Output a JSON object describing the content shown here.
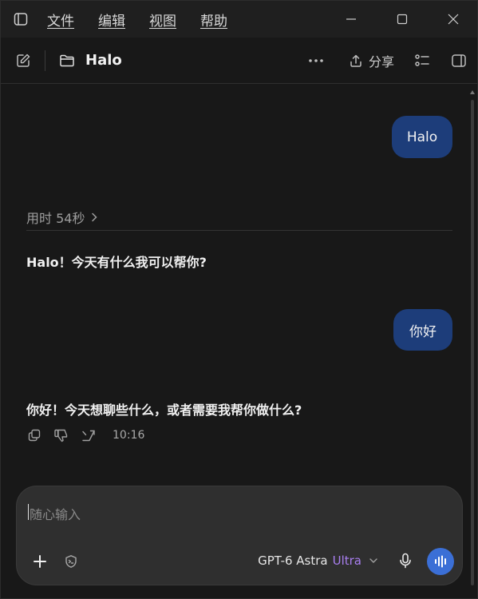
{
  "menu": {
    "items": [
      "文件",
      "编辑",
      "视图",
      "帮助"
    ]
  },
  "toolbar": {
    "title": "Halo",
    "share_label": "分享"
  },
  "chat": {
    "messages": [
      {
        "role": "user",
        "text": "Halo"
      },
      {
        "role": "assistant",
        "text": "Halo！今天有什么我可以帮你?"
      },
      {
        "role": "user",
        "text": "你好"
      },
      {
        "role": "assistant",
        "text": "你好！今天想聊些什么，或者需要我帮你做什么?"
      }
    ],
    "thinking_label": "用时 54秒",
    "last_time": "10:16"
  },
  "composer": {
    "placeholder": "随心输入",
    "model_name": "GPT-6 Astra",
    "model_tier": "Ultra"
  },
  "colors": {
    "user_bubble": "#1d3d7a",
    "accent_voice": "#3b6fd6",
    "tier": "#a97ff0"
  }
}
